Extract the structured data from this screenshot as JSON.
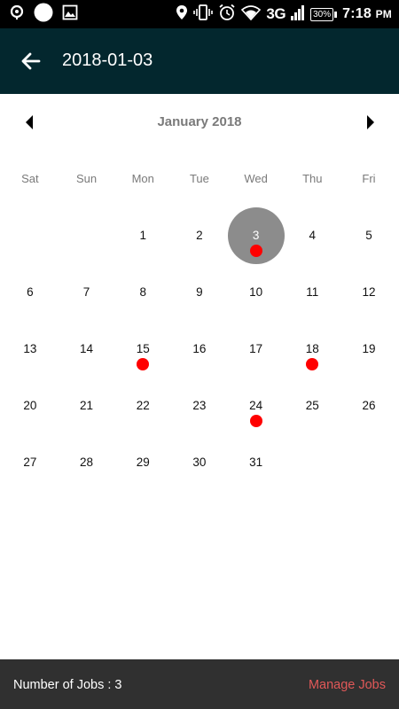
{
  "status_bar": {
    "time": "7:18",
    "ampm": "PM",
    "network": "3G",
    "battery": "30%",
    "icons": [
      "location-pin-icon",
      "circle-icon",
      "image-icon",
      "location-icon",
      "vibrate-icon",
      "alarm-icon",
      "wifi-icon",
      "signal-icon",
      "battery-icon"
    ]
  },
  "app_bar": {
    "title": "2018-01-03",
    "back_icon": "arrow-back-icon",
    "background": "#03272e"
  },
  "calendar": {
    "month_title": "January 2018",
    "weekdays": [
      "Sat",
      "Sun",
      "Mon",
      "Tue",
      "Wed",
      "Thu",
      "Fri"
    ],
    "weeks": [
      [
        "",
        "",
        "1",
        "2",
        "3",
        "4",
        "5"
      ],
      [
        "6",
        "7",
        "8",
        "9",
        "10",
        "11",
        "12"
      ],
      [
        "13",
        "14",
        "15",
        "16",
        "17",
        "18",
        "19"
      ],
      [
        "20",
        "21",
        "22",
        "23",
        "24",
        "25",
        "26"
      ],
      [
        "27",
        "28",
        "29",
        "30",
        "31",
        "",
        ""
      ]
    ],
    "selected_day": "3",
    "job_days": [
      "3",
      "15",
      "18",
      "24"
    ],
    "colors": {
      "selected": "#8c8c8c",
      "job_dot": "#ff0000"
    }
  },
  "bottom_bar": {
    "jobs_count_label": "Number of Jobs : 3",
    "manage_label": "Manage Jobs",
    "manage_color": "#e15858"
  }
}
